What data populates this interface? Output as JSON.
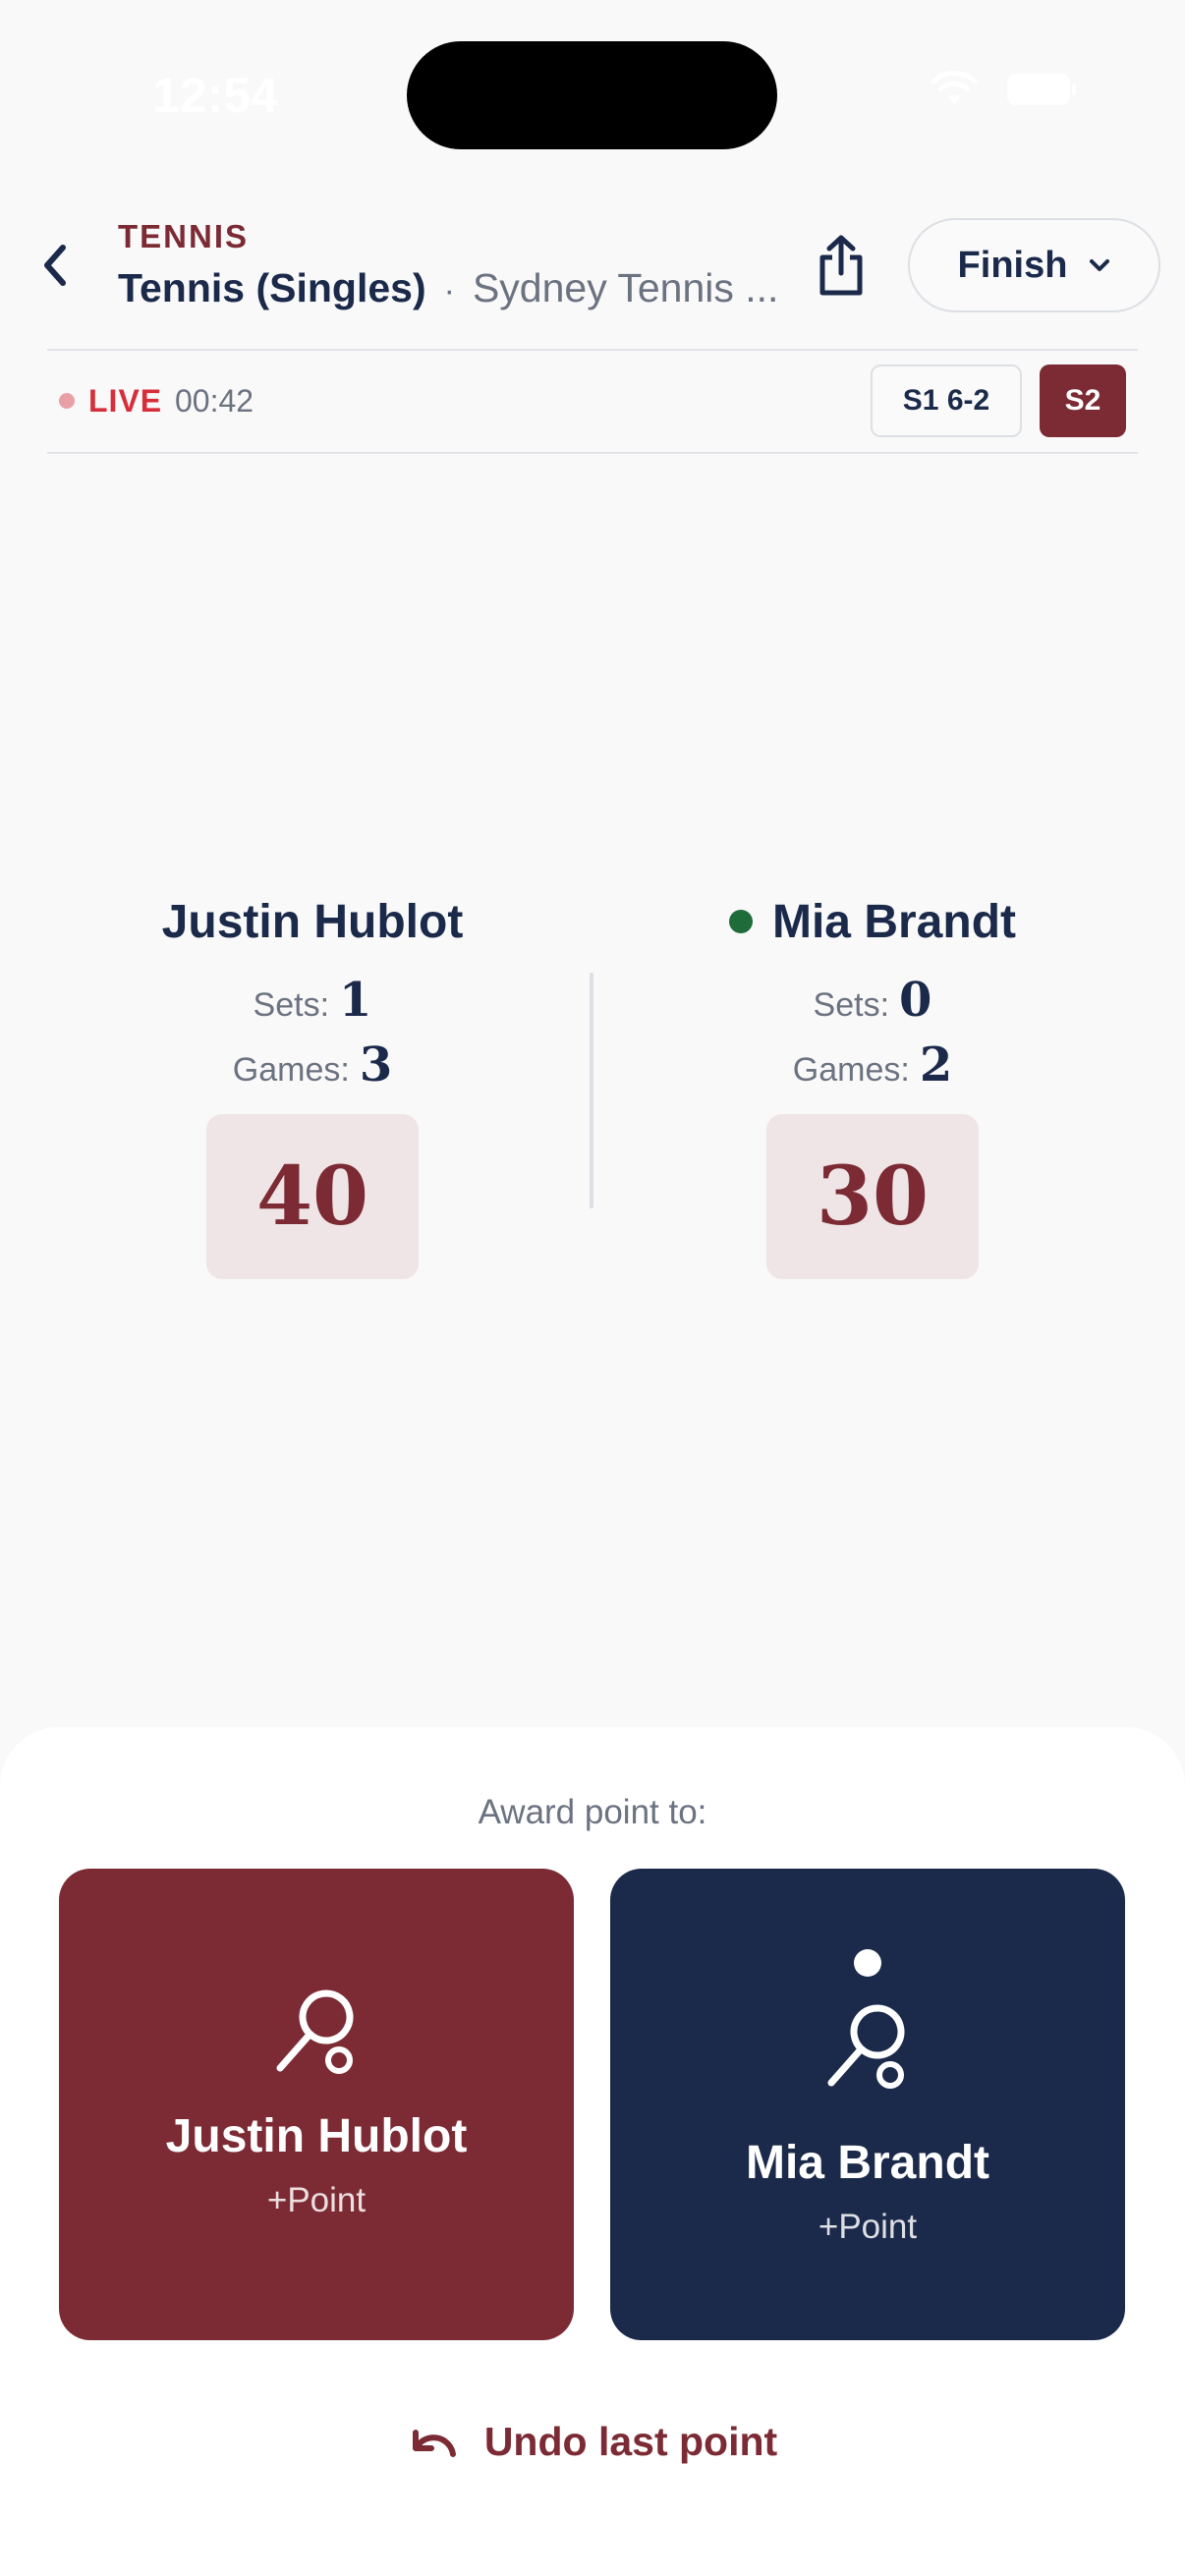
{
  "status_bar": {
    "time": "12:54"
  },
  "header": {
    "sport": "TENNIS",
    "title": "Tennis (Singles)",
    "separator": "·",
    "venue": "Sydney Tennis ...",
    "finish_label": "Finish"
  },
  "live_bar": {
    "live_label": "LIVE",
    "elapsed": "00:42",
    "sets": [
      {
        "label": "S1 6-2",
        "active": false
      },
      {
        "label": "S2",
        "active": true
      }
    ]
  },
  "players": [
    {
      "name": "Justin Hublot",
      "sets_label": "Sets:",
      "sets": "1",
      "games_label": "Games:",
      "games": "3",
      "points": "40",
      "serving": false
    },
    {
      "name": "Mia Brandt",
      "sets_label": "Sets:",
      "sets": "0",
      "games_label": "Games:",
      "games": "2",
      "points": "30",
      "serving": true
    }
  ],
  "award": {
    "prompt": "Award point to:",
    "buttons": [
      {
        "name": "Justin Hublot",
        "sub": "+Point",
        "color": "#7c2b34",
        "icon": "tennis-racket-icon"
      },
      {
        "name": "Mia Brandt",
        "sub": "+Point",
        "color": "#1b2a4a",
        "icon": "tennis-racket-ball-icon"
      }
    ]
  },
  "undo_label": "Undo last point",
  "colors": {
    "accent": "#7c2b34",
    "navy": "#1b2a4a",
    "live": "#d62e3a",
    "serve": "#1f6b3a"
  }
}
